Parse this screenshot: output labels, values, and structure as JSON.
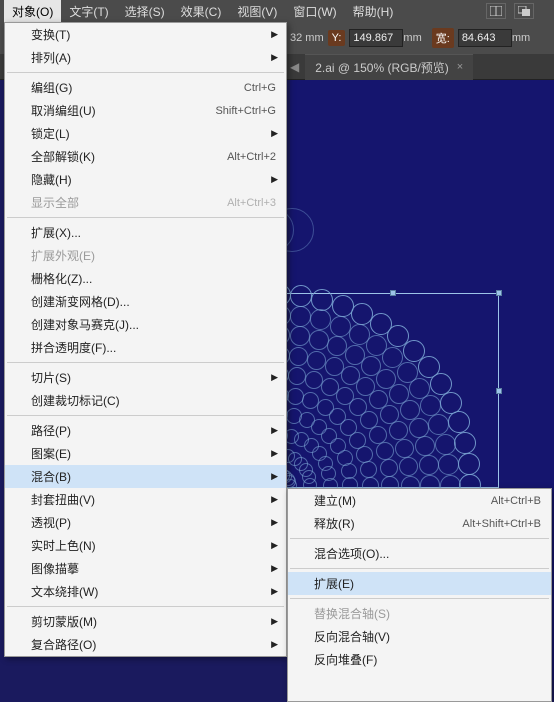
{
  "menubar": {
    "items": [
      "对象(O)",
      "文字(T)",
      "选择(S)",
      "效果(C)",
      "视图(V)",
      "窗口(W)",
      "帮助(H)"
    ]
  },
  "propbar": {
    "unit_suffix": "mm",
    "y_label": "Y:",
    "y_value": "149.867",
    "w_label": "宽:",
    "w_value": "84.643"
  },
  "tab": {
    "prev_indicator": "◀",
    "title": "2.ai @ 150% (RGB/预览)",
    "close": "×"
  },
  "menu": [
    {
      "label": "变换(T)",
      "sub": true
    },
    {
      "label": "排列(A)",
      "sub": true
    },
    {
      "sep": true
    },
    {
      "label": "编组(G)",
      "shortcut": "Ctrl+G"
    },
    {
      "label": "取消编组(U)",
      "shortcut": "Shift+Ctrl+G"
    },
    {
      "label": "锁定(L)",
      "sub": true
    },
    {
      "label": "全部解锁(K)",
      "shortcut": "Alt+Ctrl+2"
    },
    {
      "label": "隐藏(H)",
      "sub": true
    },
    {
      "label": "显示全部",
      "shortcut": "Alt+Ctrl+3",
      "disabled": true
    },
    {
      "sep": true
    },
    {
      "label": "扩展(X)..."
    },
    {
      "label": "扩展外观(E)",
      "disabled": true
    },
    {
      "label": "栅格化(Z)..."
    },
    {
      "label": "创建渐变网格(D)..."
    },
    {
      "label": "创建对象马赛克(J)..."
    },
    {
      "label": "拼合透明度(F)..."
    },
    {
      "sep": true
    },
    {
      "label": "切片(S)",
      "sub": true
    },
    {
      "label": "创建裁切标记(C)"
    },
    {
      "sep": true
    },
    {
      "label": "路径(P)",
      "sub": true
    },
    {
      "label": "图案(E)",
      "sub": true
    },
    {
      "label": "混合(B)",
      "sub": true,
      "hover": true
    },
    {
      "label": "封套扭曲(V)",
      "sub": true
    },
    {
      "label": "透视(P)",
      "sub": true
    },
    {
      "label": "实时上色(N)",
      "sub": true
    },
    {
      "label": "图像描摹",
      "sub": true
    },
    {
      "label": "文本绕排(W)",
      "sub": true
    },
    {
      "sep": true
    },
    {
      "label": "剪切蒙版(M)",
      "sub": true
    },
    {
      "label": "复合路径(O)",
      "sub": true
    }
  ],
  "submenu": [
    {
      "label": "建立(M)",
      "shortcut": "Alt+Ctrl+B"
    },
    {
      "label": "释放(R)",
      "shortcut": "Alt+Shift+Ctrl+B"
    },
    {
      "sep": true
    },
    {
      "label": "混合选项(O)..."
    },
    {
      "sep": true
    },
    {
      "label": "扩展(E)",
      "hover": true
    },
    {
      "sep": true
    },
    {
      "label": "替换混合轴(S)",
      "disabled": true
    },
    {
      "label": "反向混合轴(V)"
    },
    {
      "label": "反向堆叠(F)"
    }
  ]
}
